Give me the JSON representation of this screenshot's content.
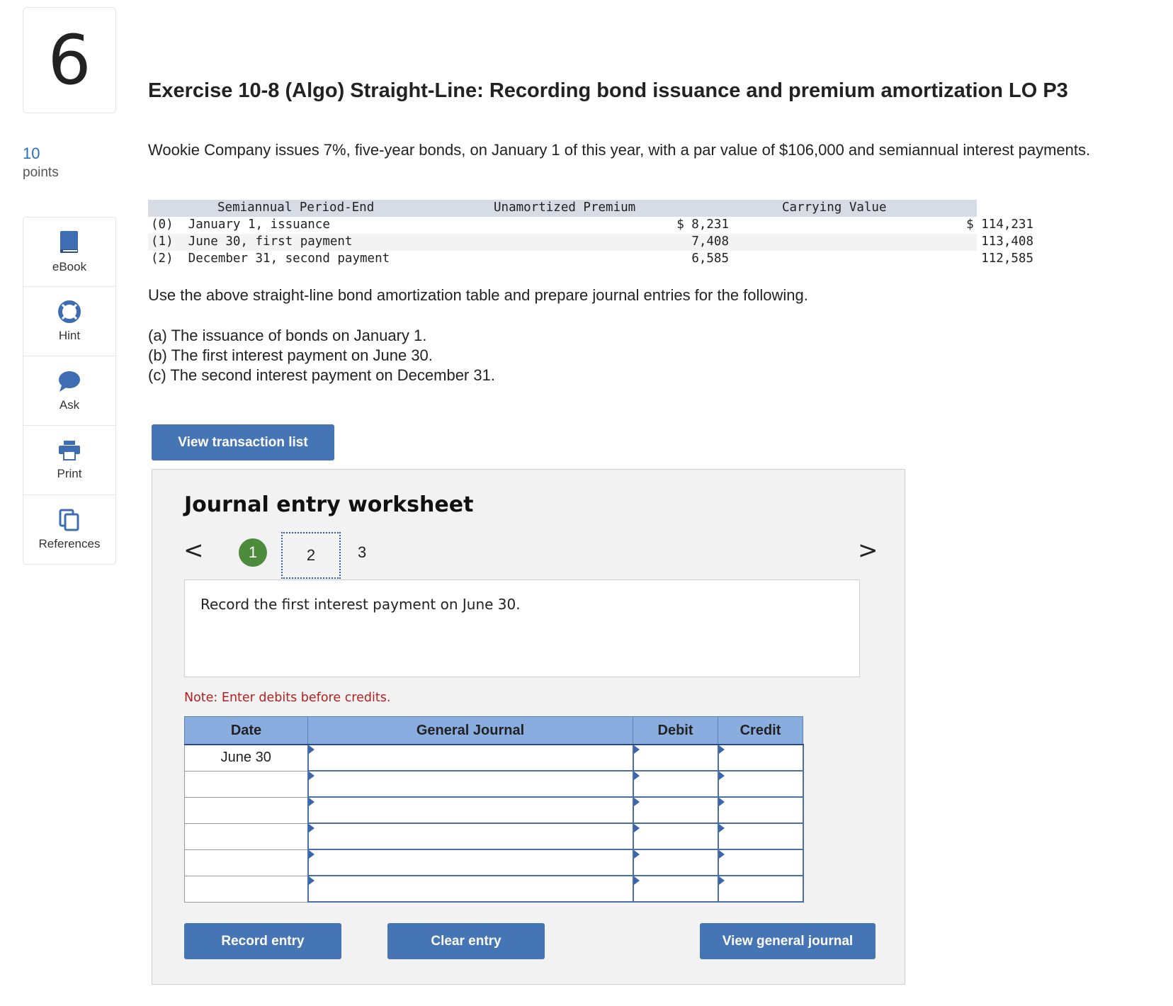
{
  "question": {
    "number": "6",
    "points_value": "10",
    "points_label": "points"
  },
  "tools": [
    {
      "label": "eBook",
      "icon": "book-icon"
    },
    {
      "label": "Hint",
      "icon": "lifebuoy-icon"
    },
    {
      "label": "Ask",
      "icon": "chat-bubble-icon"
    },
    {
      "label": "Print",
      "icon": "printer-icon"
    },
    {
      "label": "References",
      "icon": "copy-icon"
    }
  ],
  "title": "Exercise 10-8 (Algo) Straight-Line: Recording bond issuance and premium amortization LO P3",
  "intro": "Wookie Company issues 7%, five-year bonds, on January 1 of this year, with a par value of $106,000 and semiannual interest payments.",
  "amort_table": {
    "headers": {
      "period": "Semiannual Period-End",
      "premium": "Unamortized Premium",
      "carrying": "Carrying Value"
    },
    "rows": [
      {
        "label": "(0)  January 1, issuance",
        "premium": "$ 8,231",
        "carrying": "$ 114,231"
      },
      {
        "label": "(1)  June 30, first payment",
        "premium": "7,408",
        "carrying": "113,408"
      },
      {
        "label": "(2)  December 31, second payment",
        "premium": "6,585",
        "carrying": "112,585"
      }
    ]
  },
  "instruction": "Use the above straight-line bond amortization table and prepare journal entries for the following.",
  "items": [
    "(a) The issuance of bonds on January 1.",
    "(b) The first interest payment on June 30.",
    "(c) The second interest payment on December 31."
  ],
  "buttons": {
    "view_transactions": "View transaction list",
    "record": "Record entry",
    "clear": "Clear entry",
    "view_journal": "View general journal"
  },
  "worksheet": {
    "title": "Journal entry worksheet",
    "prev": "<",
    "next": ">",
    "steps": [
      "1",
      "2",
      "3"
    ],
    "prompt": "Record the first interest payment on June 30.",
    "note": "Note: Enter debits before credits.",
    "columns": {
      "date": "Date",
      "journal": "General Journal",
      "debit": "Debit",
      "credit": "Credit"
    },
    "rows": [
      {
        "date": "June 30"
      },
      {
        "date": ""
      },
      {
        "date": ""
      },
      {
        "date": ""
      },
      {
        "date": ""
      },
      {
        "date": ""
      }
    ]
  },
  "colors": {
    "button": "#4675b5",
    "table_header": "#8aade0",
    "step_complete": "#4b8b3b",
    "note": "#b02222",
    "points": "#2a6ebb"
  }
}
